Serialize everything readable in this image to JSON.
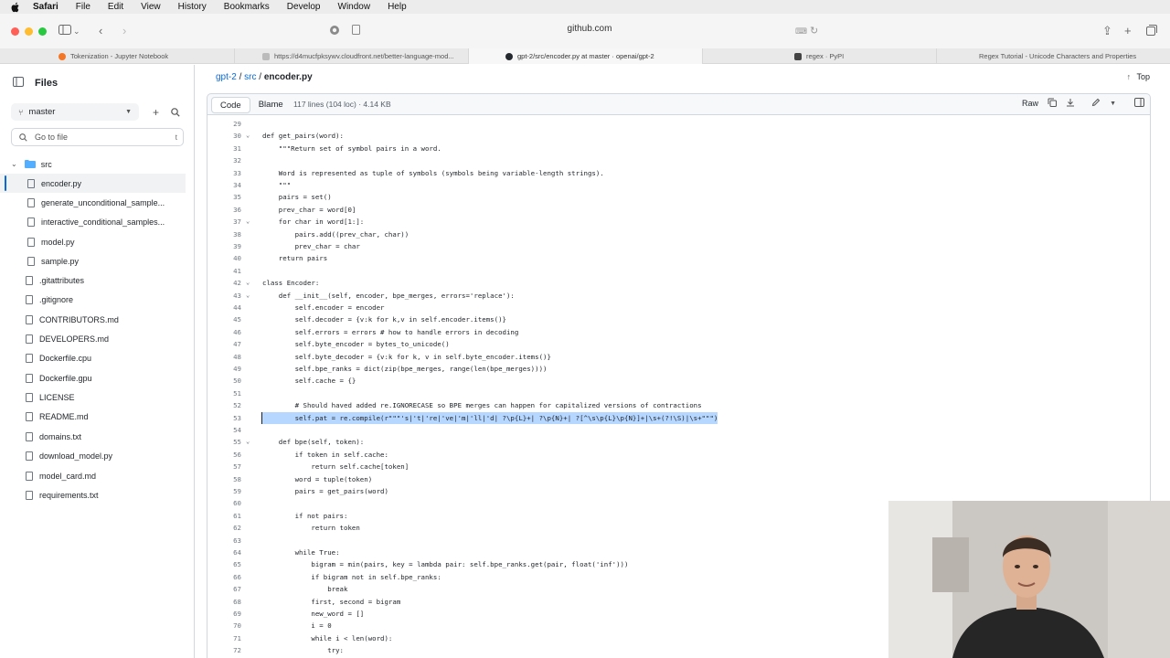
{
  "menubar": {
    "app": "Safari",
    "items": [
      "File",
      "Edit",
      "View",
      "History",
      "Bookmarks",
      "Develop",
      "Window",
      "Help"
    ]
  },
  "toolbar": {
    "address": "github.com"
  },
  "tabs": [
    {
      "label": "Tokenization - Jupyter Notebook"
    },
    {
      "label": "https://d4mucfpksywv.cloudfront.net/better-language-mod..."
    },
    {
      "label": "gpt-2/src/encoder.py at master · openai/gpt-2"
    },
    {
      "label": "regex · PyPI"
    },
    {
      "label": "Regex Tutorial - Unicode Characters and Properties"
    }
  ],
  "sidebar": {
    "title": "Files",
    "branch": "master",
    "goto_placeholder": "Go to file",
    "goto_key": "t",
    "folder": "src",
    "src_files": [
      "encoder.py",
      "generate_unconditional_sample...",
      "interactive_conditional_samples...",
      "model.py",
      "sample.py"
    ],
    "root_files": [
      ".gitattributes",
      ".gitignore",
      "CONTRIBUTORS.md",
      "DEVELOPERS.md",
      "Dockerfile.cpu",
      "Dockerfile.gpu",
      "LICENSE",
      "README.md",
      "domains.txt",
      "download_model.py",
      "model_card.md",
      "requirements.txt"
    ]
  },
  "breadcrumb": {
    "repo": "gpt-2",
    "sep1": "/",
    "dir": "src",
    "sep2": "/",
    "file": "encoder.py"
  },
  "top_label": "Top",
  "codeview": {
    "tab_code": "Code",
    "tab_blame": "Blame",
    "meta": "117 lines (104 loc) · 4.14 KB",
    "raw_label": "Raw"
  },
  "code_lines": [
    {
      "n": "29",
      "t": ""
    },
    {
      "n": "30",
      "t": "def get_pairs(word):",
      "fold": true
    },
    {
      "n": "31",
      "t": "    \"\"\"Return set of symbol pairs in a word."
    },
    {
      "n": "32",
      "t": ""
    },
    {
      "n": "33",
      "t": "    Word is represented as tuple of symbols (symbols being variable-length strings)."
    },
    {
      "n": "34",
      "t": "    \"\"\""
    },
    {
      "n": "35",
      "t": "    pairs = set()"
    },
    {
      "n": "36",
      "t": "    prev_char = word[0]"
    },
    {
      "n": "37",
      "t": "    for char in word[1:]:",
      "fold": true
    },
    {
      "n": "38",
      "t": "        pairs.add((prev_char, char))"
    },
    {
      "n": "39",
      "t": "        prev_char = char"
    },
    {
      "n": "40",
      "t": "    return pairs"
    },
    {
      "n": "41",
      "t": ""
    },
    {
      "n": "42",
      "t": "class Encoder:",
      "fold": true
    },
    {
      "n": "43",
      "t": "    def __init__(self, encoder, bpe_merges, errors='replace'):",
      "fold": true
    },
    {
      "n": "44",
      "t": "        self.encoder = encoder"
    },
    {
      "n": "45",
      "t": "        self.decoder = {v:k for k,v in self.encoder.items()}"
    },
    {
      "n": "46",
      "t": "        self.errors = errors # how to handle errors in decoding"
    },
    {
      "n": "47",
      "t": "        self.byte_encoder = bytes_to_unicode()"
    },
    {
      "n": "48",
      "t": "        self.byte_decoder = {v:k for k, v in self.byte_encoder.items()}"
    },
    {
      "n": "49",
      "t": "        self.bpe_ranks = dict(zip(bpe_merges, range(len(bpe_merges))))"
    },
    {
      "n": "50",
      "t": "        self.cache = {}"
    },
    {
      "n": "51",
      "t": ""
    },
    {
      "n": "52",
      "t": "        # Should haved added re.IGNORECASE so BPE merges can happen for capitalized versions of contractions"
    },
    {
      "n": "53",
      "t": "        self.pat = re.compile(r\"\"\"'s|'t|'re|'ve|'m|'ll|'d| ?\\p{L}+| ?\\p{N}+| ?[^\\s\\p{L}\\p{N}]+|\\s+(?!\\S)|\\s+\"\"\")",
      "hl": true
    },
    {
      "n": "54",
      "t": ""
    },
    {
      "n": "55",
      "t": "    def bpe(self, token):",
      "fold": true
    },
    {
      "n": "56",
      "t": "        if token in self.cache:"
    },
    {
      "n": "57",
      "t": "            return self.cache[token]"
    },
    {
      "n": "58",
      "t": "        word = tuple(token)"
    },
    {
      "n": "59",
      "t": "        pairs = get_pairs(word)"
    },
    {
      "n": "60",
      "t": ""
    },
    {
      "n": "61",
      "t": "        if not pairs:"
    },
    {
      "n": "62",
      "t": "            return token"
    },
    {
      "n": "63",
      "t": ""
    },
    {
      "n": "64",
      "t": "        while True:"
    },
    {
      "n": "65",
      "t": "            bigram = min(pairs, key = lambda pair: self.bpe_ranks.get(pair, float('inf')))"
    },
    {
      "n": "66",
      "t": "            if bigram not in self.bpe_ranks:"
    },
    {
      "n": "67",
      "t": "                break"
    },
    {
      "n": "68",
      "t": "            first, second = bigram"
    },
    {
      "n": "69",
      "t": "            new_word = []"
    },
    {
      "n": "70",
      "t": "            i = 0"
    },
    {
      "n": "71",
      "t": "            while i < len(word):"
    },
    {
      "n": "72",
      "t": "                try:"
    }
  ]
}
